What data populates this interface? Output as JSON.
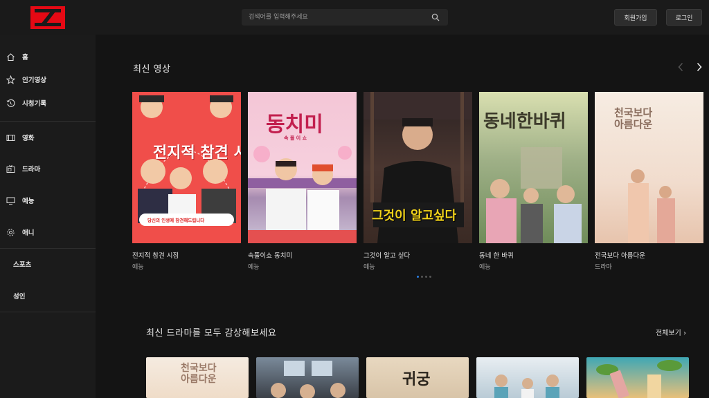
{
  "header": {
    "search_placeholder": "검색어를 입력해주세요",
    "signup_label": "회원가입",
    "login_label": "로그인"
  },
  "sidebar": {
    "items": [
      {
        "label": "홈",
        "icon": "home-icon"
      },
      {
        "label": "인기영상",
        "icon": "star-icon"
      },
      {
        "label": "시청기록",
        "icon": "history-icon"
      },
      {
        "label": "영화",
        "icon": "film-icon"
      },
      {
        "label": "드라마",
        "icon": "tv-icon"
      },
      {
        "label": "예능",
        "icon": "monitor-icon"
      },
      {
        "label": "애니",
        "icon": "gear-icon"
      },
      {
        "label": "스포츠"
      },
      {
        "label": "성인"
      }
    ]
  },
  "latest": {
    "title": "최신 영상",
    "cards": [
      {
        "title": "전지적 참견 시점",
        "category": "예능",
        "poster_text": "전지적 참견 시점",
        "poster_caption": "당신의 인생에 참견해드립니다"
      },
      {
        "title": "속풀이쇼 동치미",
        "category": "예능",
        "poster_text": "동치미",
        "poster_sub": "속 풀 이 쇼"
      },
      {
        "title": "그것이 알고 싶다",
        "category": "예능",
        "poster_text": "그것이 알고싶다"
      },
      {
        "title": "동네 한 바퀴",
        "category": "예능",
        "poster_text": "동네한바퀴"
      },
      {
        "title": "전국보다 아름다운",
        "category": "드라마",
        "poster_text": "천국보다 아름다운"
      }
    ]
  },
  "drama": {
    "title": "최신 드라마를 모두 감상해보세요",
    "see_all": "전체보기 ›",
    "thumbs": [
      {
        "poster_text": "천국보다 아름다운"
      },
      {
        "poster_text": ""
      },
      {
        "poster_text": "귀궁"
      },
      {
        "poster_text": ""
      },
      {
        "poster_text": ""
      }
    ]
  },
  "colors": {
    "brand": "#e50914",
    "accent": "#2a7de1",
    "background": "#141414"
  }
}
